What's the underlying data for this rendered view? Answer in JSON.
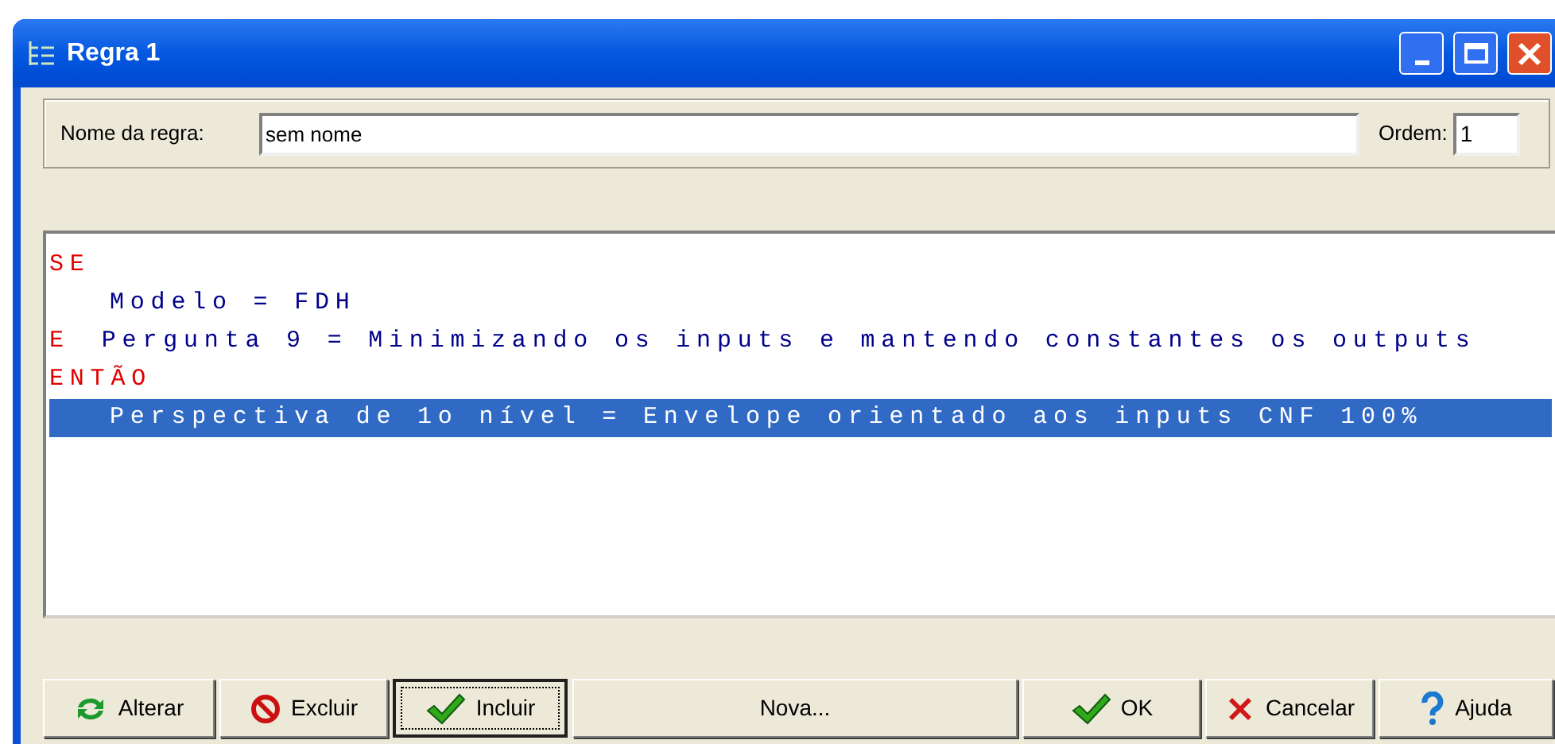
{
  "window": {
    "title": "Regra 1"
  },
  "rule_name": {
    "label": "Nome da regra:",
    "value": "sem nome"
  },
  "order": {
    "label": "Ordem:",
    "value": "1"
  },
  "rule_lines": [
    {
      "keyword": "SE",
      "selected": false
    },
    {
      "text": "Modelo = FDH",
      "selected": false
    },
    {
      "keyword": "E",
      "text": "Pergunta 9 = Minimizando os inputs e mantendo constantes os outputs",
      "selected": false
    },
    {
      "keyword": "ENTÃO",
      "selected": false
    },
    {
      "text": "Perspectiva de 1o nível = Envelope orientado aos inputs CNF 100%",
      "selected": true
    }
  ],
  "buttons": [
    {
      "label": "Alterar",
      "kind": "refresh",
      "focused": false
    },
    {
      "label": "Excluir",
      "kind": "forbidden",
      "focused": false
    },
    {
      "label": "Incluir",
      "kind": "check",
      "focused": true
    },
    {
      "label": "Nova...",
      "kind": "plain",
      "focused": false
    },
    {
      "label": "OK",
      "kind": "check",
      "focused": false
    },
    {
      "label": "Cancelar",
      "kind": "cross",
      "focused": false
    },
    {
      "label": "Ajuda",
      "kind": "help",
      "focused": false
    }
  ]
}
